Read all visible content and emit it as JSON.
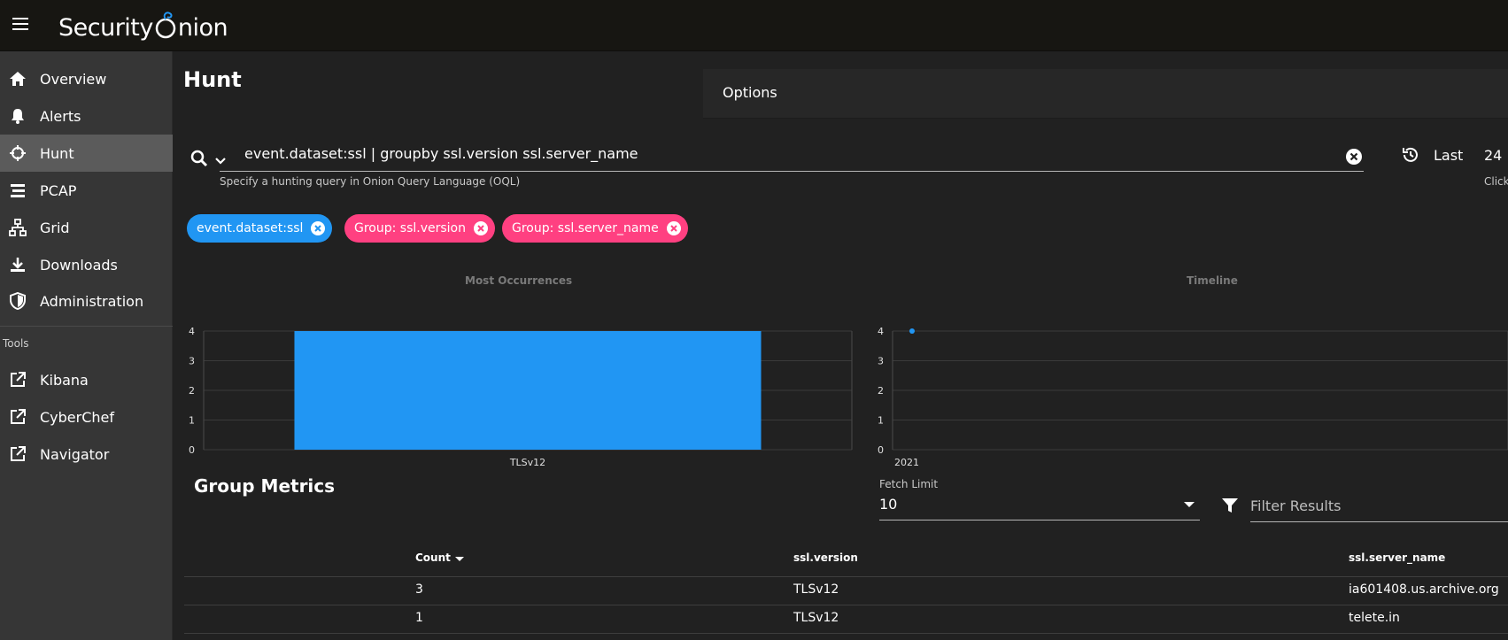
{
  "topbar": {
    "logo_text_1": "Security",
    "logo_text_2": "nion"
  },
  "sidebar": {
    "items": [
      {
        "label": "Overview",
        "icon": "home-icon"
      },
      {
        "label": "Alerts",
        "icon": "bell-icon"
      },
      {
        "label": "Hunt",
        "icon": "crosshairs-icon",
        "active": true
      },
      {
        "label": "PCAP",
        "icon": "stream-icon"
      },
      {
        "label": "Grid",
        "icon": "sitemap-icon"
      },
      {
        "label": "Downloads",
        "icon": "download-icon"
      },
      {
        "label": "Administration",
        "icon": "shield-icon"
      }
    ],
    "tools_label": "Tools",
    "tools": [
      {
        "label": "Kibana",
        "icon": "external-link-icon"
      },
      {
        "label": "CyberChef",
        "icon": "external-link-icon"
      },
      {
        "label": "Navigator",
        "icon": "external-link-icon"
      }
    ]
  },
  "main": {
    "title": "Hunt",
    "options_label": "Options",
    "query": {
      "value": "event.dataset:ssl | groupby ssl.version ssl.server_name",
      "hint": "Specify a hunting query in Onion Query Language (OQL)"
    },
    "time": {
      "label": "Last",
      "value": "24",
      "hint": "Click"
    },
    "chips": [
      {
        "label": "event.dataset:ssl",
        "color": "#2196f3"
      },
      {
        "label": "Group: ssl.version",
        "color": "#ff4081"
      },
      {
        "label": "Group: ssl.server_name",
        "color": "#ff4081"
      }
    ],
    "group_metrics": {
      "title": "Group Metrics",
      "fetch_limit_label": "Fetch Limit",
      "fetch_limit_value": "10",
      "filter_placeholder": "Filter Results",
      "columns": [
        "Count",
        "ssl.version",
        "ssl.server_name"
      ],
      "rows": [
        [
          "3",
          "TLSv12",
          "ia601408.us.archive.org"
        ],
        [
          "1",
          "TLSv12",
          "telete.in"
        ]
      ]
    }
  },
  "chart_data": [
    {
      "type": "bar",
      "title": "Most Occurrences",
      "categories": [
        "TLSv12"
      ],
      "values": [
        4
      ],
      "yticks": [
        "0",
        "1",
        "2",
        "3",
        "4"
      ],
      "ylim": [
        0,
        4
      ],
      "color": "#2196f3"
    },
    {
      "type": "line",
      "title": "Timeline",
      "x": [
        "2021"
      ],
      "values": [
        4
      ],
      "yticks": [
        "0",
        "1",
        "2",
        "3",
        "4"
      ],
      "ylim": [
        0,
        4
      ],
      "color": "#2196f3"
    }
  ]
}
